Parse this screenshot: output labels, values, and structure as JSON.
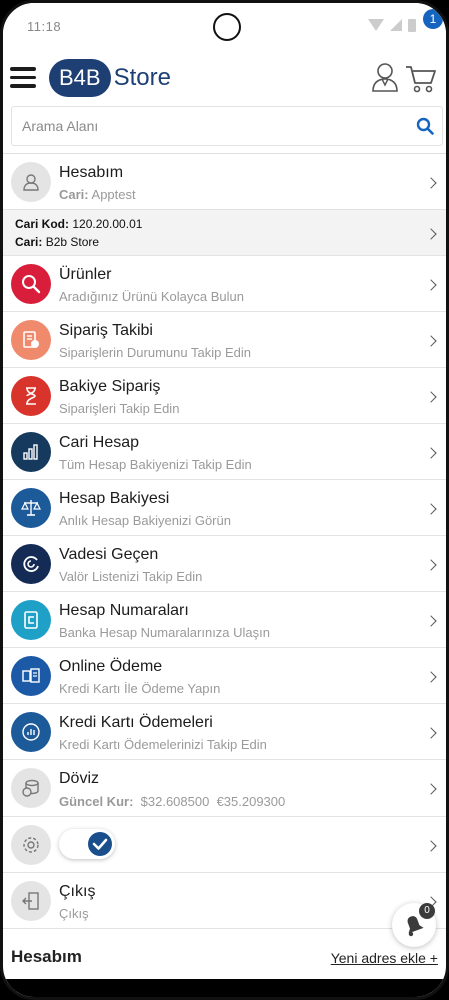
{
  "status_bar": {
    "time": "11:18"
  },
  "header": {
    "logo_b4b": "B4B",
    "logo_store": "Store",
    "cart_count": "1"
  },
  "search": {
    "placeholder": "Arama Alanı"
  },
  "account": {
    "title": "Hesabım",
    "sub_label": "Cari:",
    "sub_value": "Apptest",
    "cari_kod_label": "Cari Kod:",
    "cari_kod_value": "120.20.00.01",
    "cari_label": "Cari:",
    "cari_value": "B2b Store"
  },
  "menu": [
    {
      "title": "Ürünler",
      "subtitle": "Aradığınız Ürünü Kolayca Bulun",
      "icon": "search-icon",
      "color": "#d81e3a"
    },
    {
      "title": "Sipariş Takibi",
      "subtitle": "Siparişlerin Durumunu Takip Edin",
      "icon": "order-tracking-icon",
      "color": "#f08a6c"
    },
    {
      "title": "Bakiye Sipariş",
      "subtitle": "Siparişleri Takip Edin",
      "icon": "hourglass-icon",
      "color": "#d9342b"
    },
    {
      "title": "Cari Hesap",
      "subtitle": "Tüm Hesap Bakiyenizi Takip Edin",
      "icon": "bar-chart-icon",
      "color": "#163a5e"
    },
    {
      "title": "Hesap Bakiyesi",
      "subtitle": "Anlık Hesap Bakiyenizi Görün",
      "icon": "balance-scale-icon",
      "color": "#1c5a9a"
    },
    {
      "title": "Vadesi Geçen",
      "subtitle": "Valör Listenizi Takip Edin",
      "icon": "due-icon",
      "color": "#142b55"
    },
    {
      "title": "Hesap Numaraları",
      "subtitle": "Banka Hesap Numaralarınıza Ulaşın",
      "icon": "bank-account-icon",
      "color": "#1fa0c7"
    },
    {
      "title": "Online Ödeme",
      "subtitle": "Kredi Kartı İle Ödeme Yapın",
      "icon": "online-payment-icon",
      "color": "#1c5aa8"
    },
    {
      "title": "Kredi Kartı Ödemeleri",
      "subtitle": "Kredi Kartı Ödemelerinizi Takip Edin",
      "icon": "card-payments-icon",
      "color": "#1c5a9a"
    }
  ],
  "currency": {
    "title": "Döviz",
    "rate_label": "Güncel Kur:",
    "usd": "$32.608500",
    "eur": "€35.209300"
  },
  "logout": {
    "title": "Çıkış",
    "subtitle": "Çıkış"
  },
  "notifications": {
    "count": "0"
  },
  "footer": {
    "section_title": "Hesabım",
    "add_address": "Yeni adres ekle +"
  },
  "colors": {
    "brand": "#1d3f73",
    "accent": "#1565c0"
  }
}
